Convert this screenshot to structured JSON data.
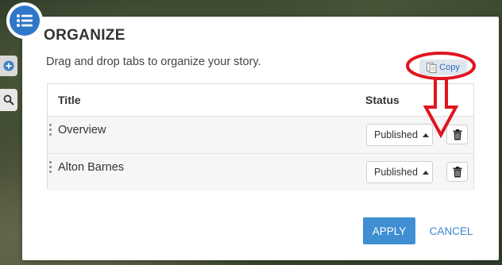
{
  "dialog": {
    "title": "ORGANIZE",
    "subtitle": "Drag and drop tabs to organize your story.",
    "copy_label": "Copy"
  },
  "table": {
    "headers": {
      "title": "Title",
      "status": "Status"
    },
    "rows": [
      {
        "title": "Overview",
        "status": "Published"
      },
      {
        "title": "Alton Barnes",
        "status": "Published"
      }
    ]
  },
  "footer": {
    "apply_label": "APPLY",
    "cancel_label": "CANCEL"
  },
  "colors": {
    "accent": "#3f8fd2",
    "annotation": "#e0151f"
  },
  "icons": [
    "list-icon",
    "copy-icon",
    "caret-up-icon",
    "trash-icon",
    "plus-icon",
    "search-icon"
  ]
}
